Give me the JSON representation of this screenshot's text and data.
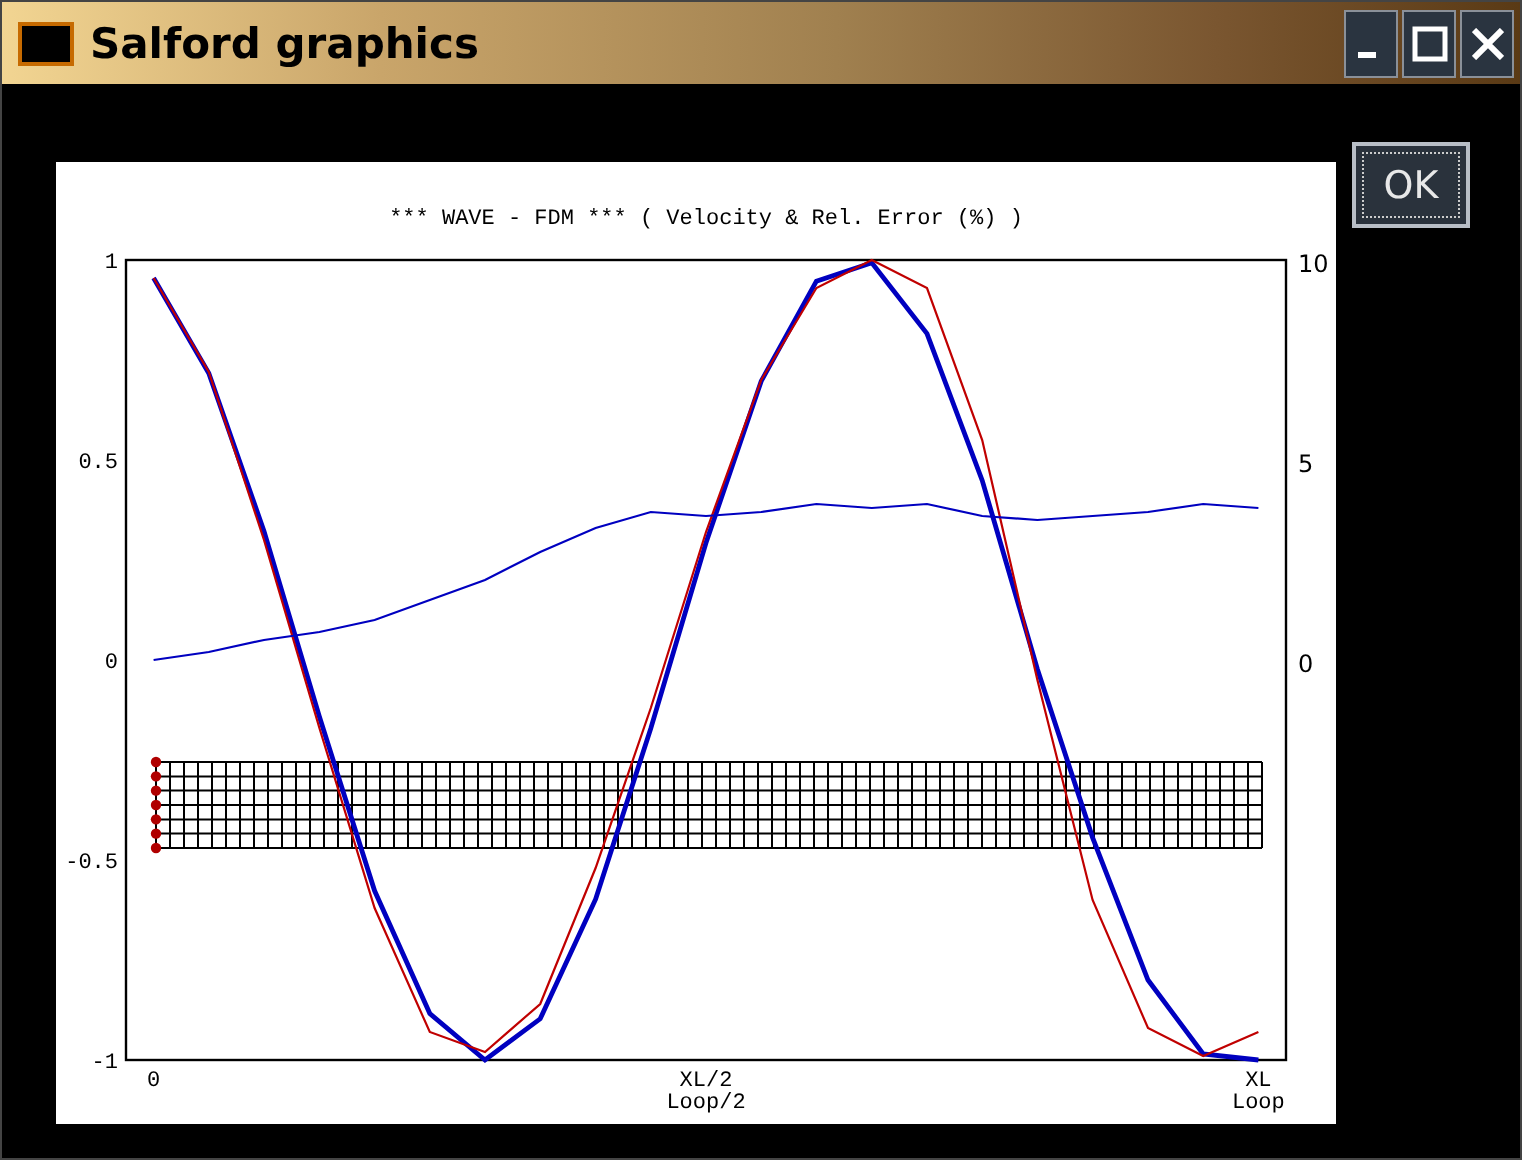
{
  "window": {
    "title": "Salford graphics"
  },
  "ok_button": {
    "label": "OK"
  },
  "plot": {
    "chart_data": {
      "type": "line",
      "title": "*** WAVE - FDM *** ( Velocity & Rel. Error (%) )",
      "categories": [
        "0",
        null,
        null,
        null,
        null,
        null,
        null,
        null,
        null,
        null,
        "XL/2\nLoop/2",
        null,
        null,
        null,
        null,
        null,
        null,
        null,
        null,
        null,
        "XL\nLoop"
      ],
      "series": [
        {
          "color": "#0000c0",
          "values": [
            0.955,
            0.717,
            0.322,
            -0.142,
            -0.577,
            -0.884,
            -1.0,
            -0.897,
            -0.598,
            -0.171,
            0.293,
            0.697,
            0.947,
            0.993,
            0.816,
            0.449,
            -0.023,
            -0.444,
            -0.8,
            -0.985,
            -1.0
          ]
        },
        {
          "color": "#c00000",
          "values": [
            0.955,
            0.72,
            0.3,
            -0.17,
            -0.62,
            -0.93,
            -0.98,
            -0.86,
            -0.52,
            -0.12,
            0.32,
            0.7,
            0.93,
            1.0,
            0.93,
            0.55,
            -0.05,
            -0.6,
            -0.92,
            -0.99,
            -0.93
          ]
        },
        {
          "color": "#0000c0",
          "axis": "y2",
          "values": [
            0,
            0.2,
            0.5,
            0.7,
            1.0,
            1.5,
            2.0,
            2.7,
            3.3,
            3.7,
            3.6,
            3.7,
            3.9,
            3.8,
            3.9,
            3.6,
            3.5,
            3.6,
            3.7,
            3.9,
            3.8
          ]
        }
      ],
      "ylim": [
        -1,
        1
      ],
      "yticks": [
        {
          "value": -1,
          "label": "-1"
        },
        {
          "value": -0.5,
          "label": "-0.5"
        },
        {
          "value": 0,
          "label": "0"
        },
        {
          "value": 0.5,
          "label": "0.5"
        },
        {
          "value": 1,
          "label": "1"
        }
      ],
      "y2lim": [
        -10,
        10
      ],
      "y2ticks": [
        {
          "value": 0,
          "label": "0"
        },
        {
          "value": 5,
          "label": "5"
        },
        {
          "value": 10,
          "label": "10"
        }
      ]
    }
  }
}
